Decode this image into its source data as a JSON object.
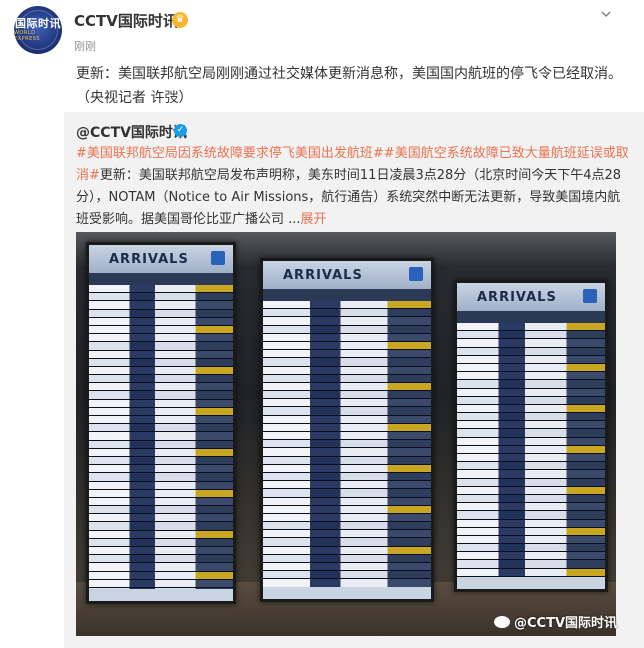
{
  "post": {
    "username": "CCTV国际时讯",
    "time": "刚刚",
    "text": "更新：美国联邦航空局刚刚通过社交媒体更新消息称，美国国内航班的停飞令已经取消。（央视记者 许弢）",
    "vip_icon": "crown-badge-icon",
    "menu_icon": "chevron-down-icon",
    "avatar_logo": "国际时讯",
    "avatar_sub": "WORLD EXPRESS"
  },
  "retweet": {
    "username": "@CCTV国际时讯",
    "hashtag1": "#美国联邦航空局因系统故障要求停飞美国出发航班#",
    "hashtag2": "#美国航空系统故障已致大量航班延误或取消#",
    "body": "更新：美国联邦航空局发布声明称，美东时间11日凌晨3点28分（北京时间今天下午4点28分），NOTAM（Notice to Air Missions，航行通告）系统突然中断无法更新，导致美国境内航班受影响。据美国哥伦比亚广播公司 ...",
    "expand_label": "展开"
  },
  "photo": {
    "boards": [
      {
        "title": "ARRIVALS"
      },
      {
        "title": "ARRIVALS"
      },
      {
        "title": "ARRIVALS"
      }
    ],
    "watermark": "@CCTV国际时讯"
  },
  "colors": {
    "accent": "#eb7350",
    "verified": "#1a9de6",
    "vip": "#f7b531"
  }
}
